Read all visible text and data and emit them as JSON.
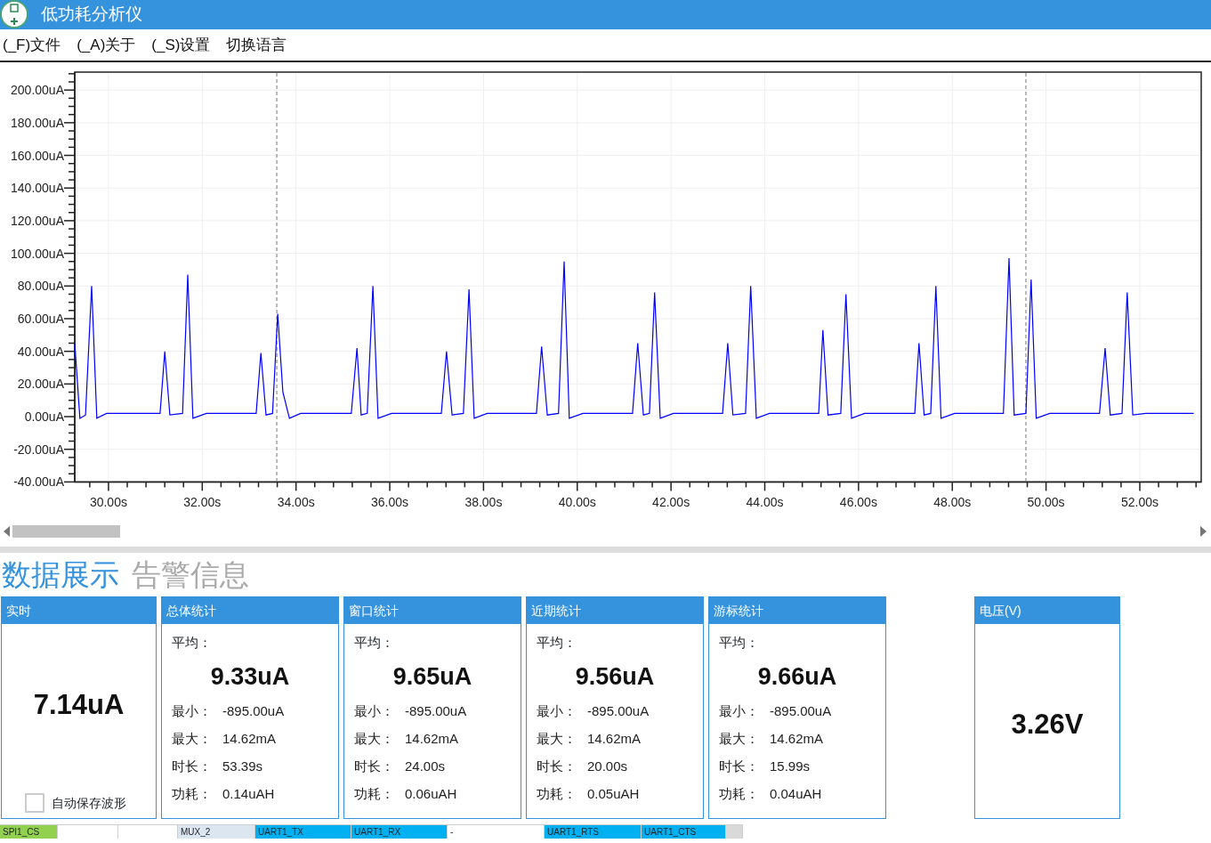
{
  "window": {
    "title": "低功耗分析仪"
  },
  "menu": [
    {
      "label": "(_F)文件"
    },
    {
      "label": "(_A)关于"
    },
    {
      "label": "(_S)设置"
    },
    {
      "label": "切换语言"
    }
  ],
  "chart": {
    "chart_data": {
      "type": "line",
      "grid": true,
      "xlim": [
        29.28,
        53.31
      ],
      "ylim": [
        -40,
        211
      ],
      "xticks": [
        {
          "value": 30,
          "label": "30.00s"
        },
        {
          "value": 32,
          "label": "32.00s"
        },
        {
          "value": 34,
          "label": "34.00s"
        },
        {
          "value": 36,
          "label": "36.00s"
        },
        {
          "value": 38,
          "label": "38.00s"
        },
        {
          "value": 40,
          "label": "40.00s"
        },
        {
          "value": 42,
          "label": "42.00s"
        },
        {
          "value": 44,
          "label": "44.00s"
        },
        {
          "value": 46,
          "label": "46.00s"
        },
        {
          "value": 48,
          "label": "48.00s"
        },
        {
          "value": 50,
          "label": "50.00s"
        },
        {
          "value": 52,
          "label": "52.00s"
        }
      ],
      "yticks": [
        {
          "value": 200,
          "label": "200.00uA"
        },
        {
          "value": 180,
          "label": "180.00uA"
        },
        {
          "value": 160,
          "label": "160.00uA"
        },
        {
          "value": 140,
          "label": "140.00uA"
        },
        {
          "value": 120,
          "label": "120.00uA"
        },
        {
          "value": 100,
          "label": "100.00uA"
        },
        {
          "value": 80,
          "label": "80.00uA"
        },
        {
          "value": 60,
          "label": "60.00uA"
        },
        {
          "value": 40,
          "label": "40.00uA"
        },
        {
          "value": 20,
          "label": "20.00uA"
        },
        {
          "value": 0,
          "label": "0.00uA"
        },
        {
          "value": -20,
          "label": "-20.00uA"
        },
        {
          "value": -40,
          "label": "-40.00uA"
        }
      ],
      "x": [
        29.28,
        29.39,
        29.51,
        29.64,
        29.75,
        29.96,
        31.1,
        31.2,
        31.31,
        31.58,
        31.69,
        31.8,
        32.09,
        33.15,
        33.25,
        33.36,
        33.5,
        33.61,
        33.72,
        33.86,
        34.1,
        35.18,
        35.3,
        35.39,
        35.52,
        35.64,
        35.75,
        36.04,
        37.1,
        37.21,
        37.33,
        37.57,
        37.69,
        37.8,
        38.08,
        39.13,
        39.24,
        39.36,
        39.6,
        39.72,
        39.83,
        40.12,
        41.18,
        41.29,
        41.41,
        41.54,
        41.65,
        41.77,
        42.05,
        43.1,
        43.21,
        43.32,
        43.59,
        43.7,
        43.82,
        44.1,
        45.15,
        45.24,
        45.35,
        45.62,
        45.73,
        45.85,
        46.13,
        47.2,
        47.29,
        47.4,
        47.54,
        47.65,
        47.76,
        48.05,
        49.09,
        49.21,
        49.32,
        49.57,
        49.68,
        49.79,
        50.08,
        51.14,
        51.26,
        51.37,
        51.62,
        51.73,
        51.85,
        52.13,
        53.15
      ],
      "series": [
        {
          "color": "#0000ff",
          "values": [
            45,
            -1,
            1,
            80,
            -1,
            2,
            2,
            40,
            1,
            2,
            87,
            -1,
            2,
            2,
            39,
            1,
            2,
            63,
            15,
            -1,
            2,
            2,
            42,
            1,
            2,
            80,
            -1,
            2,
            2,
            40,
            1,
            2,
            78,
            -1,
            2,
            2,
            43,
            1,
            2,
            95,
            -1,
            2,
            2,
            45,
            1,
            2,
            76,
            -1,
            2,
            2,
            45,
            1,
            2,
            80,
            -1,
            2,
            2,
            53,
            1,
            2,
            75,
            -1,
            2,
            2,
            45,
            1,
            2,
            80,
            -1,
            2,
            2,
            97,
            1,
            2,
            84,
            -1,
            2,
            2,
            42,
            1,
            2,
            76,
            1,
            2,
            2
          ]
        }
      ],
      "ref_lines": [
        {
          "axis": "x",
          "value": 33.59
        },
        {
          "axis": "x",
          "value": 49.57
        }
      ]
    }
  },
  "tabs": [
    {
      "label": "数据展示",
      "selected": true
    },
    {
      "label": "告警信息",
      "selected": false
    }
  ],
  "realtime": {
    "title": "实时",
    "value": "7.14uA",
    "auto_save": {
      "label": "自动保存波形",
      "checked": false
    }
  },
  "stat_cards": [
    {
      "title": "总体统计",
      "avg_label": "平均：",
      "avg": "9.33uA",
      "rows": [
        {
          "label": "最小：",
          "value": "-895.00uA"
        },
        {
          "label": "最大：",
          "value": "14.62mA"
        },
        {
          "label": "时长：",
          "value": "53.39s"
        },
        {
          "label": "功耗：",
          "value": "0.14uAH"
        }
      ]
    },
    {
      "title": "窗口统计",
      "avg_label": "平均：",
      "avg": "9.65uA",
      "rows": [
        {
          "label": "最小：",
          "value": "-895.00uA"
        },
        {
          "label": "最大：",
          "value": "14.62mA"
        },
        {
          "label": "时长：",
          "value": "24.00s"
        },
        {
          "label": "功耗：",
          "value": "0.06uAH"
        }
      ]
    },
    {
      "title": "近期统计",
      "avg_label": "平均：",
      "avg": "9.56uA",
      "rows": [
        {
          "label": "最小：",
          "value": "-895.00uA"
        },
        {
          "label": "最大：",
          "value": "14.62mA"
        },
        {
          "label": "时长：",
          "value": "20.00s"
        },
        {
          "label": "功耗：",
          "value": "0.05uAH"
        }
      ]
    },
    {
      "title": "游标统计",
      "avg_label": "平均：",
      "avg": "9.66uA",
      "rows": [
        {
          "label": "最小：",
          "value": "-895.00uA"
        },
        {
          "label": "最大：",
          "value": "14.62mA"
        },
        {
          "label": "时长：",
          "value": "15.99s"
        },
        {
          "label": "功耗：",
          "value": "0.04uAH"
        }
      ]
    }
  ],
  "voltage": {
    "title": "电压(V)",
    "value": "3.26V"
  },
  "status_strip": [
    {
      "text": "SPI1_CS",
      "color": "#92d050"
    },
    {
      "color": "#ffffff"
    },
    {
      "color": "#ffffff"
    },
    {
      "text": "MUX_2",
      "color": "#dce6f1"
    },
    {
      "text": "UART1_TX",
      "color": "#00b0f0"
    },
    {
      "text": "UART1_RX",
      "color": "#00b0f0"
    },
    {
      "text": "-",
      "color": "#ffffff"
    },
    {
      "text": "UART1_RTS",
      "color": "#00b0f0"
    },
    {
      "text": "UART1_CTS",
      "color": "#00b0f0"
    },
    {
      "color": "#d9d9d9"
    }
  ]
}
